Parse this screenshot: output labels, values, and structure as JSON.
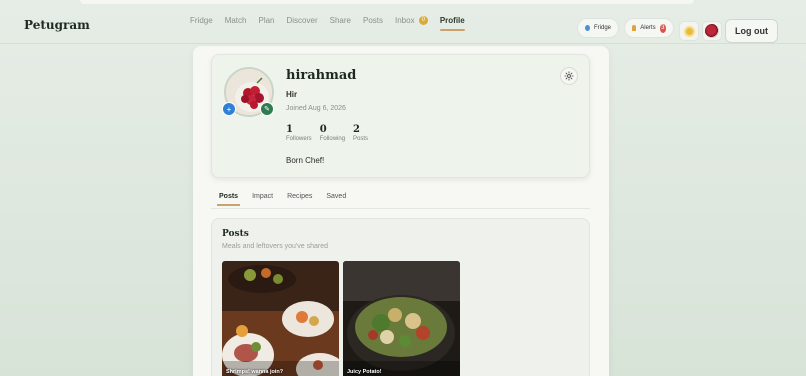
{
  "app": {
    "brand": "Petugram"
  },
  "nav": {
    "items": [
      {
        "label": "Fridge"
      },
      {
        "label": "Match"
      },
      {
        "label": "Plan"
      },
      {
        "label": "Discover"
      },
      {
        "label": "Share"
      },
      {
        "label": "Posts"
      },
      {
        "label": "Inbox",
        "badge": "0"
      },
      {
        "label": "Profile",
        "active": true
      }
    ]
  },
  "header_actions": {
    "fridge_label": "Fridge",
    "alerts_label": "Alerts",
    "alerts_count": "3",
    "logout_label": "Log out"
  },
  "profile": {
    "username": "hirahmad",
    "display_name": "Hir",
    "joined": "Joined Aug 6, 2026",
    "stats": {
      "followers_count": "1",
      "followers_label": "Followers",
      "following_count": "0",
      "following_label": "Following",
      "posts_count": "2",
      "posts_label": "Posts"
    },
    "bio": "Born Chef!"
  },
  "tabs": [
    {
      "label": "Posts",
      "active": true
    },
    {
      "label": "Impact"
    },
    {
      "label": "Recipes"
    },
    {
      "label": "Saved"
    }
  ],
  "posts_section": {
    "title": "Posts",
    "subtitle": "Meals and leftovers you've shared",
    "items": [
      {
        "caption": "Shrimps! wanna join?"
      },
      {
        "caption": "Juicy Potato!"
      }
    ]
  },
  "colors": {
    "accent": "#c9a36a",
    "alert_badge": "#d9534f",
    "avatar_plus": "#2f7fd6",
    "avatar_edit": "#2f7c4e"
  },
  "icons": [
    "fridge-dot-icon",
    "bell-icon",
    "sun-icon",
    "user-avatar",
    "gear-icon",
    "plus-icon",
    "pencil-icon"
  ]
}
